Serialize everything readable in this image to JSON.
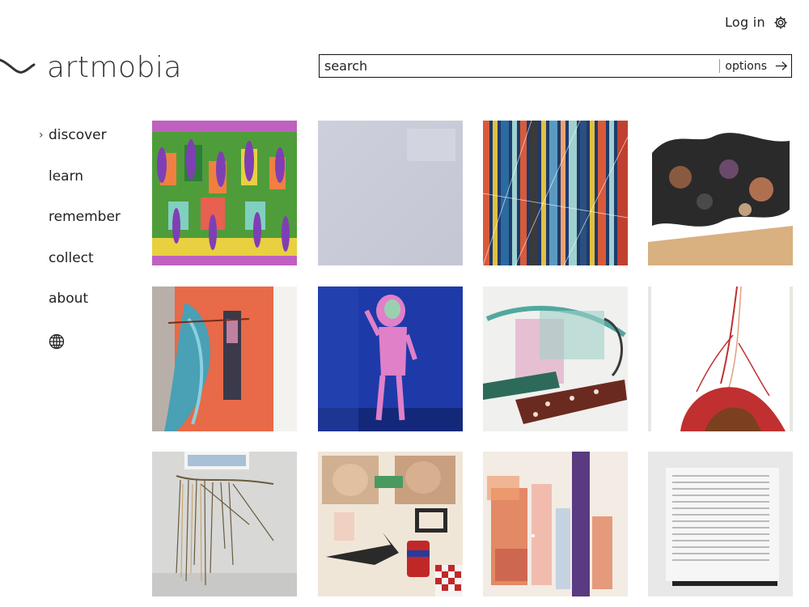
{
  "header": {
    "login_label": "Log in",
    "brand": "artmobia"
  },
  "search": {
    "placeholder": "search",
    "options_label": "options"
  },
  "nav": {
    "items": [
      {
        "label": "discover",
        "active": true
      },
      {
        "label": "learn"
      },
      {
        "label": "remember"
      },
      {
        "label": "collect"
      },
      {
        "label": "about"
      }
    ]
  },
  "icons": {
    "settings": "gear-icon",
    "language": "globe-icon",
    "submit": "arrow-right-icon",
    "active_marker": "chevron-right-icon"
  },
  "artworks": [
    {
      "id": "art-1",
      "palette": [
        "#7f3fb4",
        "#4f9d3a",
        "#f08040",
        "#e8d040"
      ]
    },
    {
      "id": "art-2",
      "palette": [
        "#c9ccd8",
        "#d6d8e2"
      ]
    },
    {
      "id": "art-3",
      "palette": [
        "#1f3a6a",
        "#d85a3a",
        "#9ed0d0",
        "#e0c040"
      ]
    },
    {
      "id": "art-4",
      "palette": [
        "#2a2a2a",
        "#b07050",
        "#d9c7a6",
        "#ffffff"
      ]
    },
    {
      "id": "art-5",
      "palette": [
        "#e86a48",
        "#4aa0b4",
        "#b8b0a8"
      ]
    },
    {
      "id": "art-6",
      "palette": [
        "#1e3aa8",
        "#e080c8",
        "#3a3060"
      ]
    },
    {
      "id": "art-7",
      "palette": [
        "#f0f0ee",
        "#50a8a0",
        "#6b2a20",
        "#e0a0c0"
      ]
    },
    {
      "id": "art-8",
      "palette": [
        "#ffffff",
        "#c03030",
        "#7a4020"
      ]
    },
    {
      "id": "art-9",
      "palette": [
        "#d8d8d6",
        "#6a5a40",
        "#c8a060"
      ]
    },
    {
      "id": "art-10",
      "palette": [
        "#e0d0c0",
        "#c02828",
        "#2a2a2a",
        "#f0e6d8"
      ]
    },
    {
      "id": "art-11",
      "palette": [
        "#f2ece4",
        "#e07850",
        "#5a3a80",
        "#c0d0e0"
      ]
    },
    {
      "id": "art-12",
      "palette": [
        "#e8e8e8",
        "#f6f6f6",
        "#555555"
      ]
    }
  ]
}
